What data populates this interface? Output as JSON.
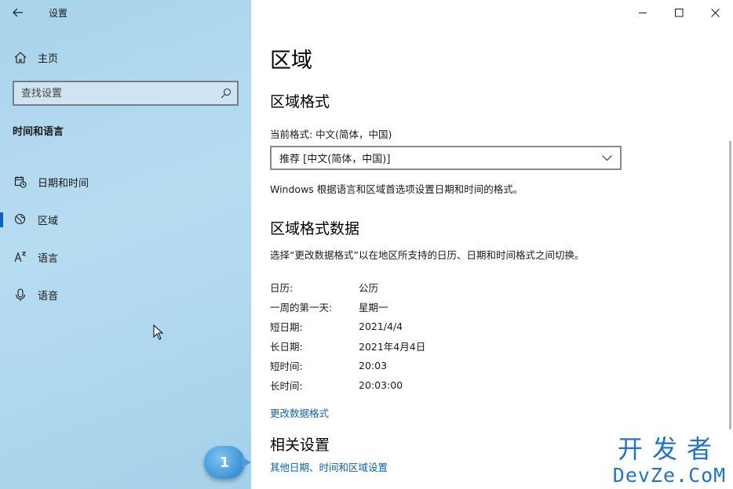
{
  "window": {
    "app_title": "设置",
    "controls": [
      "minimize-icon",
      "maximize-icon",
      "close-icon"
    ]
  },
  "sidebar": {
    "home_label": "主页",
    "search_placeholder": "查找设置",
    "section_heading": "时间和语言",
    "items": [
      {
        "label": "日期和时间",
        "icon": "calendar-clock-icon",
        "selected": false
      },
      {
        "label": "区域",
        "icon": "globe-icon",
        "selected": true
      },
      {
        "label": "语言",
        "icon": "language-icon",
        "selected": false
      },
      {
        "label": "语音",
        "icon": "microphone-icon",
        "selected": false
      }
    ],
    "accent_color": "#0a61c8"
  },
  "main": {
    "page_title": "区域",
    "region_format": {
      "heading": "区域格式",
      "current_label": "当前格式: 中文(简体，中国)",
      "dropdown_value": "推荐 [中文(简体，中国)]",
      "description": "Windows 根据语言和区域首选项设置日期和时间的格式。"
    },
    "format_data": {
      "heading": "区域格式数据",
      "description": "选择“更改数据格式”以在地区所支持的日历、日期和时间格式之间切换。",
      "rows": [
        {
          "key": "日历:",
          "value": "公历"
        },
        {
          "key": "一周的第一天:",
          "value": "星期一"
        },
        {
          "key": "短日期:",
          "value": "2021/4/4"
        },
        {
          "key": "长日期:",
          "value": "2021年4月4日"
        },
        {
          "key": "短时间:",
          "value": "20:03"
        },
        {
          "key": "长时间:",
          "value": "20:03:00"
        }
      ],
      "change_link": "更改数据格式"
    },
    "related": {
      "heading": "相关设置",
      "link": "其他日期、时间和区域设置"
    },
    "link_color": "#0a64b4"
  },
  "annotation": {
    "badge_number": "1"
  },
  "watermark": {
    "cn": "开发者",
    "en": "DevZe.CoM"
  }
}
